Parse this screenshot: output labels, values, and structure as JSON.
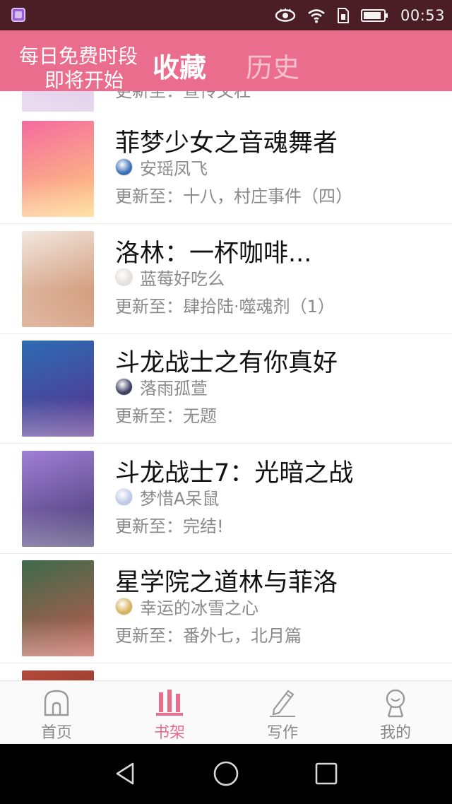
{
  "status_bar": {
    "time": "00:53",
    "icons": [
      "notification-app-icon",
      "eye-icon",
      "wifi-icon",
      "sim-icon",
      "battery-icon"
    ]
  },
  "header": {
    "promo_line1": "每日免费时段",
    "promo_line2": "即将开始",
    "tabs": [
      {
        "label": "收藏",
        "active": true
      },
      {
        "label": "历史",
        "active": false
      }
    ],
    "bg_color": "#ea6d8d"
  },
  "books": [
    {
      "title": "",
      "author": "",
      "update": "更新至：宣传文杠",
      "cover_colors": [
        "#f3e7f4",
        "#d9c4e6"
      ]
    },
    {
      "title": "菲梦少女之音魂舞者",
      "author": "安瑶凤飞",
      "update": "更新至：十八，村庄事件（四）",
      "cover_colors": [
        "#f56aa0",
        "#ffd27a"
      ],
      "avatar_color": "#3b6fb7"
    },
    {
      "title": "洛林：一杯咖啡...",
      "author": "蓝莓好吃么",
      "update": "更新至：肆拾陆·噬魂剂（1）",
      "cover_colors": [
        "#f2e8e0",
        "#c77e55"
      ],
      "avatar_color": "#e6e0dc"
    },
    {
      "title": "斗龙战士之有你真好",
      "author": "落雨孤萱",
      "update": "更新至：无题",
      "cover_colors": [
        "#2c6cb3",
        "#5a2f8c"
      ],
      "avatar_color": "#3d3f63"
    },
    {
      "title": "斗龙战士7：光暗之战",
      "author": "梦惜A呆鼠",
      "update": "更新至：完结!",
      "cover_colors": [
        "#a17fd6",
        "#40366d"
      ],
      "avatar_color": "#bcc9e8"
    },
    {
      "title": "星学院之道林与菲洛",
      "author": "幸运的冰雪之心",
      "update": "更新至：番外七，北月篇",
      "cover_colors": [
        "#3d6b4a",
        "#c4594f"
      ],
      "avatar_color": "#d8b15a"
    },
    {
      "title": "",
      "author": "",
      "update": "",
      "cover_colors": [
        "#b44a3a",
        "#6d2a22"
      ]
    }
  ],
  "bottom_nav": [
    {
      "label": "首页",
      "icon": "home-icon",
      "active": false
    },
    {
      "label": "书架",
      "icon": "bookshelf-icon",
      "active": true
    },
    {
      "label": "写作",
      "icon": "pencil-icon",
      "active": false
    },
    {
      "label": "我的",
      "icon": "profile-icon",
      "active": false
    }
  ],
  "system_nav": [
    "back-icon",
    "home-circle-icon",
    "recents-icon"
  ]
}
